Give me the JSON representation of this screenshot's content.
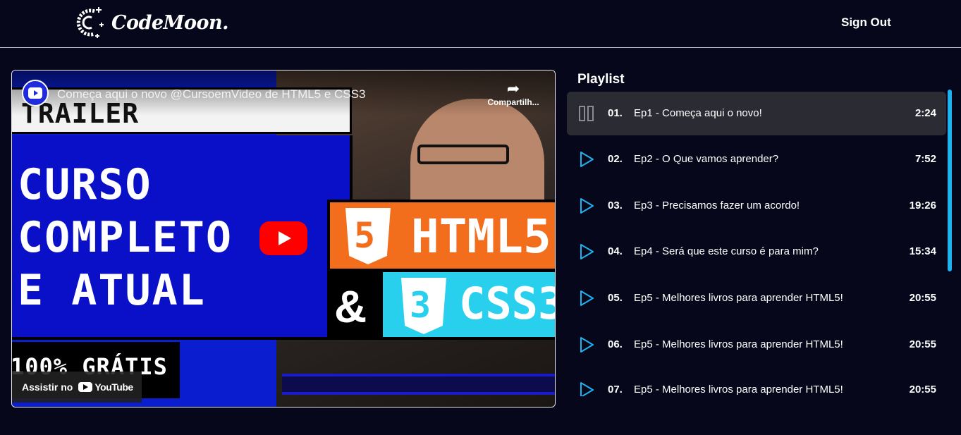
{
  "header": {
    "brand": "CodeMoon.",
    "sign_out": "Sign Out"
  },
  "video": {
    "yt_title": "Começa aqui o novo @CursoemVideo de HTML5 e CSS3",
    "share_label": "Compartilh...",
    "watch_on": "Assistir no",
    "youtube": "YouTube",
    "thumb": {
      "trailer": "TRAILER",
      "line1": "CURSO",
      "line2": "COMPLETO",
      "line3": "E ATUAL",
      "free": "100% GRÁTIS",
      "html": "HTML5",
      "css": "CSS3",
      "amp": "&",
      "five": "5",
      "three": "3"
    }
  },
  "playlist": {
    "title": "Playlist",
    "items": [
      {
        "num": "01.",
        "name": "Ep1 - Começa aqui o novo!",
        "duration": "2:24",
        "state": "playing"
      },
      {
        "num": "02.",
        "name": "Ep2 - O Que vamos aprender?",
        "duration": "7:52",
        "state": "idle"
      },
      {
        "num": "03.",
        "name": "Ep3 - Precisamos fazer um acordo!",
        "duration": "19:26",
        "state": "idle"
      },
      {
        "num": "04.",
        "name": "Ep4 - Será que este curso é para mim?",
        "duration": "15:34",
        "state": "idle"
      },
      {
        "num": "05.",
        "name": "Ep5 - Melhores livros para aprender HTML5!",
        "duration": "20:55",
        "state": "idle"
      },
      {
        "num": "06.",
        "name": "Ep5 - Melhores livros para aprender HTML5!",
        "duration": "20:55",
        "state": "idle"
      },
      {
        "num": "07.",
        "name": "Ep5 - Melhores livros para aprender HTML5!",
        "duration": "20:55",
        "state": "idle"
      }
    ]
  },
  "colors": {
    "background": "#06071a",
    "accent": "#1db3f0",
    "active_row": "#2a2b33"
  }
}
